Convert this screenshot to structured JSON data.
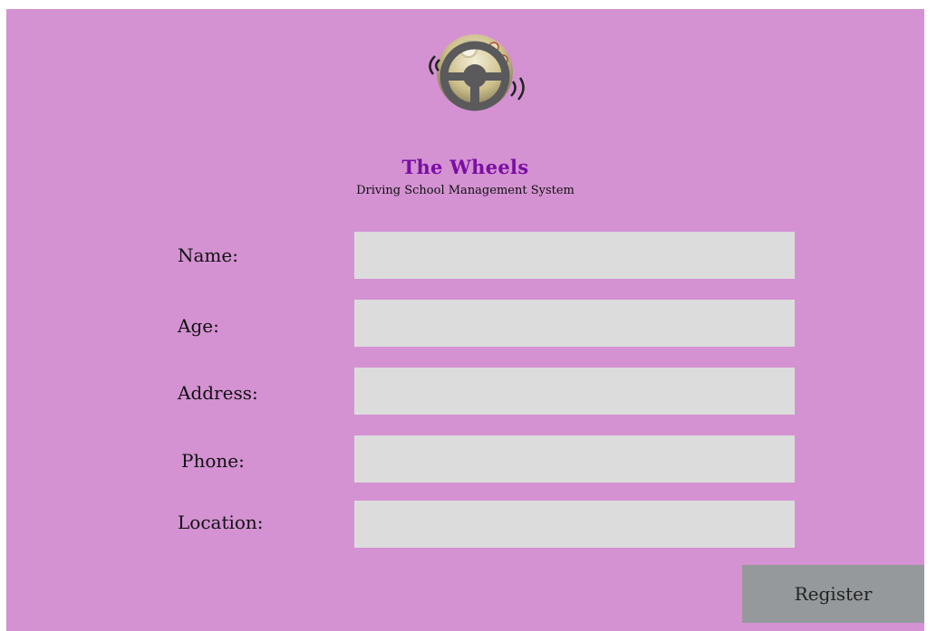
{
  "brand": {
    "title": "The Wheels",
    "subtitle": "Driving School Management System",
    "logo_icon": "steering-wheel-icon"
  },
  "form": {
    "fields": [
      {
        "label": "Name:",
        "value": "",
        "placeholder": ""
      },
      {
        "label": "Age:",
        "value": "",
        "placeholder": ""
      },
      {
        "label": "Address:",
        "value": "",
        "placeholder": ""
      },
      {
        "label": "Phone:",
        "value": "",
        "placeholder": ""
      },
      {
        "label": "Location:",
        "value": "",
        "placeholder": ""
      }
    ],
    "submit_label": "Register"
  },
  "colors": {
    "background": "#d492d2",
    "title": "#7a0ea3",
    "input": "#dcdcdc",
    "button": "#95999b"
  }
}
